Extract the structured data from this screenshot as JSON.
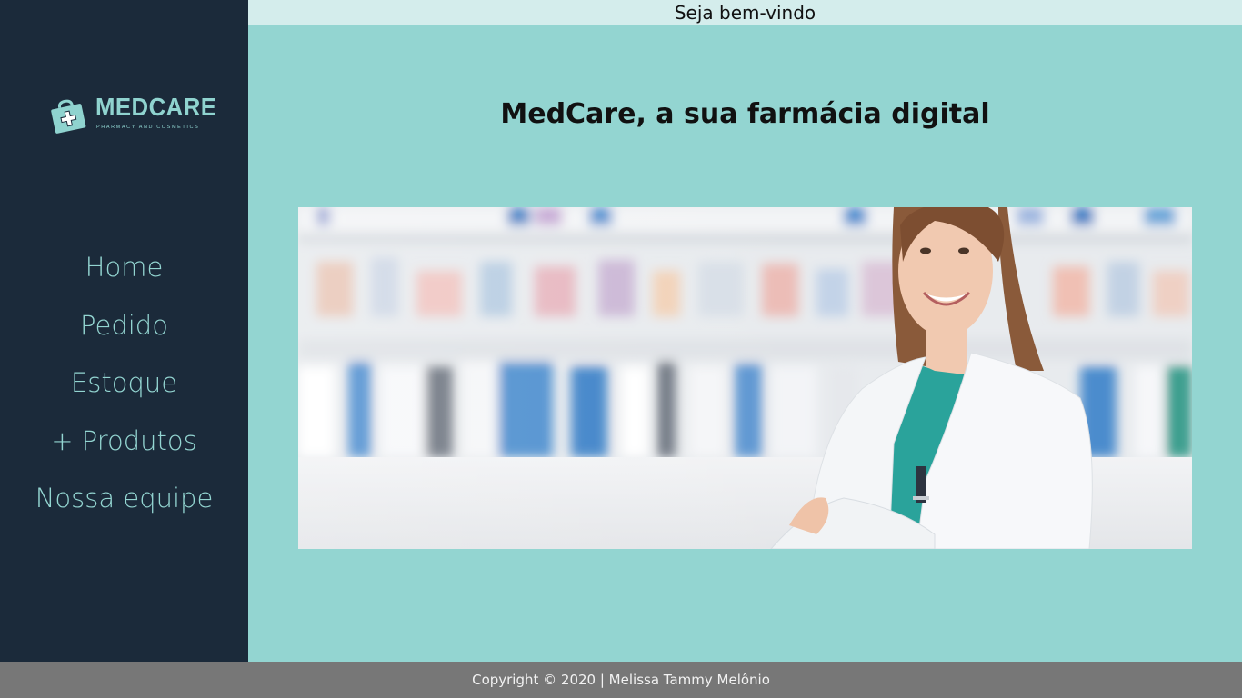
{
  "sidebar": {
    "logo": {
      "name": "MEDCARE",
      "tagline": "PHARMACY AND COSMETICS"
    },
    "nav": [
      {
        "label": "Home"
      },
      {
        "label": "Pedido"
      },
      {
        "label": "Estoque"
      },
      {
        "label": "+ Produtos"
      },
      {
        "label": "Nossa equipe"
      }
    ]
  },
  "header": {
    "welcome": "Seja bem-vindo"
  },
  "main": {
    "headline": "MedCare, a sua farmácia digital",
    "hero_image": "pharmacist-photo"
  },
  "footer": {
    "copyright": "Copyright © 2020 | Melissa Tammy Melônio"
  },
  "colors": {
    "sidebar_bg": "#1b2a3a",
    "main_bg": "#93d5d1",
    "topbar_bg": "#d4edec",
    "accent": "#8fd3cf",
    "footer_bg": "#777777"
  }
}
